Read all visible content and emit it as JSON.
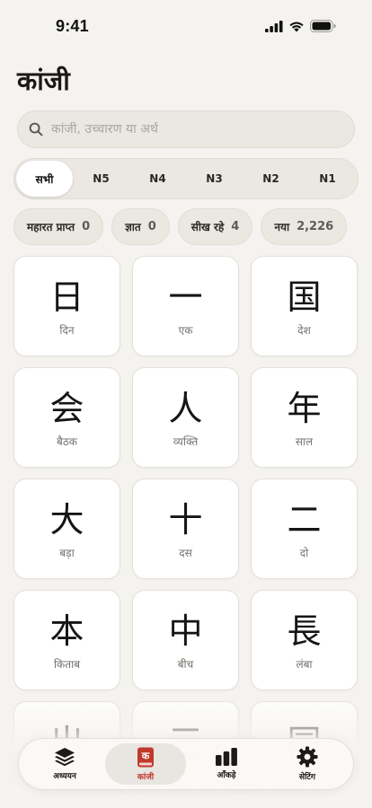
{
  "status_bar": {
    "time": "9:41"
  },
  "page": {
    "title": "कांजी"
  },
  "search": {
    "placeholder": "कांजी, उच्चारण या अर्थ",
    "value": ""
  },
  "levels": [
    {
      "label": "सभी",
      "active": true
    },
    {
      "label": "N5",
      "active": false
    },
    {
      "label": "N4",
      "active": false
    },
    {
      "label": "N3",
      "active": false
    },
    {
      "label": "N2",
      "active": false
    },
    {
      "label": "N1",
      "active": false
    }
  ],
  "stats": [
    {
      "label": "महारत प्राप्त",
      "count": "0"
    },
    {
      "label": "ज्ञात",
      "count": "0"
    },
    {
      "label": "सीख रहे",
      "count": "4"
    },
    {
      "label": "नया",
      "count": "2,226"
    }
  ],
  "kanji_cards": [
    {
      "kanji": "日",
      "meaning": "दिन"
    },
    {
      "kanji": "一",
      "meaning": "एक"
    },
    {
      "kanji": "国",
      "meaning": "देश"
    },
    {
      "kanji": "会",
      "meaning": "बैठक"
    },
    {
      "kanji": "人",
      "meaning": "व्यक्ति"
    },
    {
      "kanji": "年",
      "meaning": "साल"
    },
    {
      "kanji": "大",
      "meaning": "बड़ा"
    },
    {
      "kanji": "十",
      "meaning": "दस"
    },
    {
      "kanji": "二",
      "meaning": "दो"
    },
    {
      "kanji": "本",
      "meaning": "किताब"
    },
    {
      "kanji": "中",
      "meaning": "बीच"
    },
    {
      "kanji": "長",
      "meaning": "लंबा"
    },
    {
      "kanji": "出",
      "meaning": ""
    },
    {
      "kanji": "三",
      "meaning": ""
    },
    {
      "kanji": "同",
      "meaning": ""
    }
  ],
  "tabbar": [
    {
      "label": "अध्ययन",
      "icon": "layers-icon",
      "active": false
    },
    {
      "label": "कांजी",
      "icon": "kanji-book-icon",
      "active": true
    },
    {
      "label": "आँकड़े",
      "icon": "bar-chart-icon",
      "active": false
    },
    {
      "label": "सेटिंग",
      "icon": "gear-icon",
      "active": false
    }
  ],
  "colors": {
    "background": "#f5f3ef",
    "accent": "#c0392b",
    "card": "#ffffff"
  }
}
